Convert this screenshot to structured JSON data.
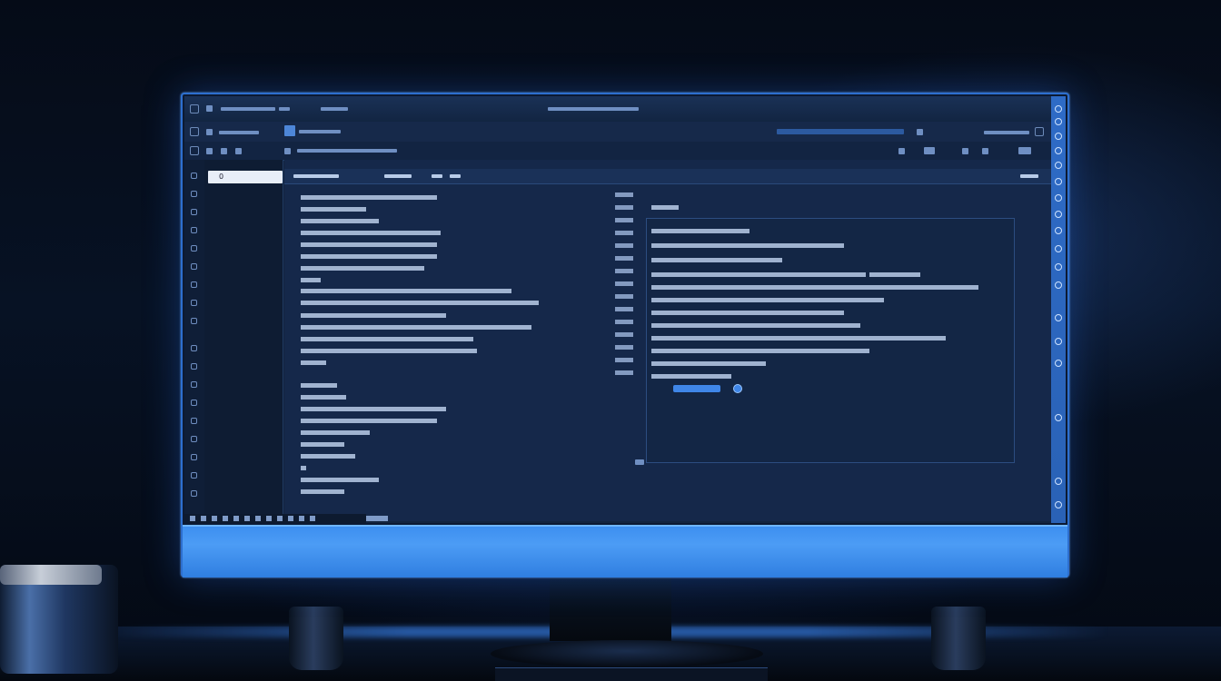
{
  "scene": {
    "description_tags": [
      "monitor",
      "code-editor",
      "desk",
      "speaker",
      "cup"
    ],
    "accent_color": "#3f86e8",
    "chin_color": "#4c9cf5"
  },
  "editor": {
    "sidebar_field_text": "0"
  },
  "icons": [
    "tb-icon",
    "gear-icon",
    "close-icon",
    "search-icon"
  ]
}
